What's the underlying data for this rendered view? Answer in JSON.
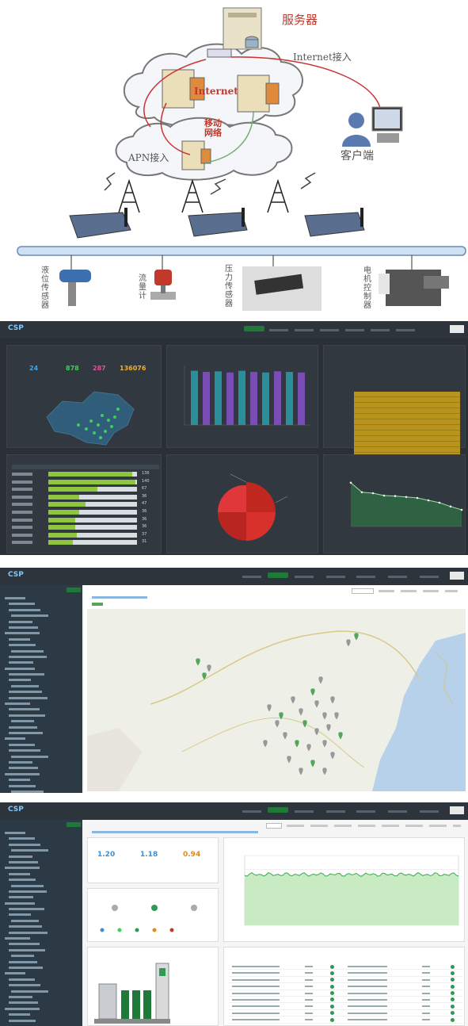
{
  "diagram": {
    "server_label": "服务器",
    "internet_access_label": "Internet接入",
    "internet_label": "Internet",
    "mobile_network_label": "移动\n网络",
    "apn_label": "APN接入",
    "client_label": "客户端",
    "devices": [
      {
        "label": "液\n位\n传\n感\n器"
      },
      {
        "label": "流\n量\n计"
      },
      {
        "label": "压\n力\n传\n感\n器"
      },
      {
        "label": "电\n机\n控\n制\n器"
      }
    ]
  },
  "dashboard": {
    "logo": "CSP",
    "stats": [
      {
        "value": "24",
        "color": "#38a8f0"
      },
      {
        "value": "878",
        "color": "#3ccf5a"
      },
      {
        "value": "287",
        "color": "#e0509a"
      },
      {
        "value": "136076",
        "color": "#f0b030"
      }
    ],
    "bar_chart": {
      "bars": [
        0.95,
        0.93,
        0.94,
        0.92,
        0.95,
        0.93,
        0.92,
        0.94,
        0.93,
        0.92
      ],
      "colors": [
        "#2a8f9a",
        "#7a4db5"
      ]
    },
    "ranking_values": [
      "136",
      "140",
      "67",
      "36",
      "47",
      "36",
      "36",
      "36",
      "37",
      "31"
    ],
    "ranking_fill": [
      0.95,
      0.98,
      0.55,
      0.35,
      0.42,
      0.35,
      0.3,
      0.3,
      0.32,
      0.28
    ],
    "line_points": [
      0.92,
      0.72,
      0.7,
      0.65,
      0.64,
      0.62,
      0.6,
      0.55,
      0.5,
      0.42,
      0.35
    ]
  },
  "map_view": {
    "tabs_right_active": "运营概况"
  },
  "monitor": {
    "metrics": [
      {
        "value": "1.20",
        "color": "#3a8fd6"
      },
      {
        "value": "1.18",
        "color": "#3a8fd6"
      },
      {
        "value": "0.94",
        "color": "#e08a1c"
      }
    ]
  },
  "colors": {
    "accent": "#1f7a3a",
    "dark_bg": "#2b3036",
    "card_bg": "#31383f"
  }
}
